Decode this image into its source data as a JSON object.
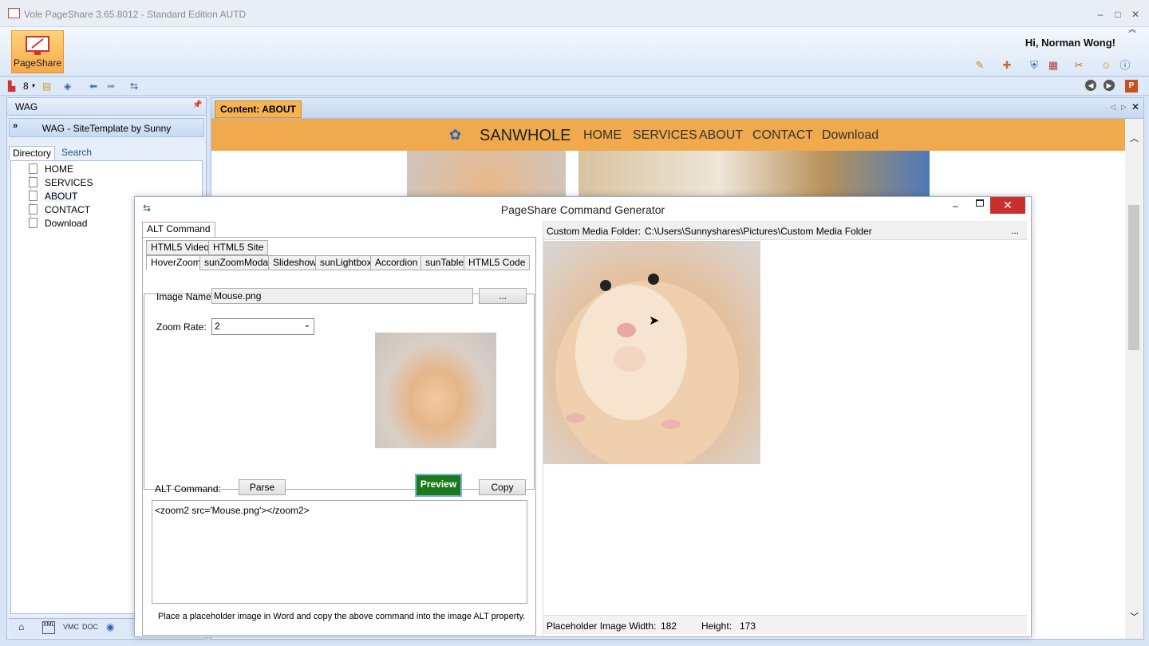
{
  "window": {
    "title": "Vole PageShare  3.65.8012 - Standard Edition AUTD",
    "minimize": "–",
    "maximize": "□",
    "close": "✕"
  },
  "ribbon": {
    "pageshare_label": "PageShare",
    "greeting": "Hi, Norman Wong!",
    "icons": [
      "palette-icon",
      "tools-icon",
      "shield-icon",
      "chart-icon",
      "key-icon",
      "face-icon",
      "info-icon"
    ]
  },
  "toolbar": {
    "count": "8",
    "nav_back": "◀",
    "nav_fwd": "▶"
  },
  "left_panel": {
    "title": "WAG",
    "pin": "📌",
    "site": "WAG - SiteTemplate by Sunny",
    "tabs": [
      "Directory",
      "Search"
    ],
    "tree": [
      "HOME",
      "SERVICES",
      "ABOUT",
      "CONTACT",
      "Download"
    ]
  },
  "content": {
    "tab_label": "Content: ABOUT",
    "site_name": "SANWHOLE",
    "nav": [
      "HOME",
      "SERVICES",
      "ABOUT",
      "CONTACT",
      "Download"
    ]
  },
  "dialog": {
    "title": "PageShare Command Generator",
    "close": "✕",
    "top_tab": "ALT Command",
    "tabs_row1": [
      "HTML5 Video",
      "HTML5 Site"
    ],
    "tabs_row2": [
      "HoverZoom",
      "sunZoomModal",
      "Slideshow",
      "sunLightbox",
      "Accordion",
      "sunTable",
      "HTML5 Code"
    ],
    "image_name_label": "Image Name:",
    "image_name_value": "Mouse.png",
    "browse_label": "...",
    "zoom_rate_label": "Zoom Rate:",
    "zoom_rate_value": "2",
    "alt_command_label": "ALT Command:",
    "parse_label": "Parse",
    "preview_label": "Preview",
    "copy_label": "Copy",
    "command_text": "<zoom2 src='Mouse.png'></zoom2>",
    "instruction": "Place a placeholder image in Word and copy the above command into the image ALT property.",
    "media_folder_label": "Custom Media Folder:",
    "media_folder_path": "C:\\Users\\Sunnyshares\\Pictures\\Custom Media Folder",
    "media_folder_more": "...",
    "placeholder_width_label": "Placeholder Image Width:",
    "placeholder_width": "182",
    "height_label": "Height:",
    "height": "173"
  }
}
